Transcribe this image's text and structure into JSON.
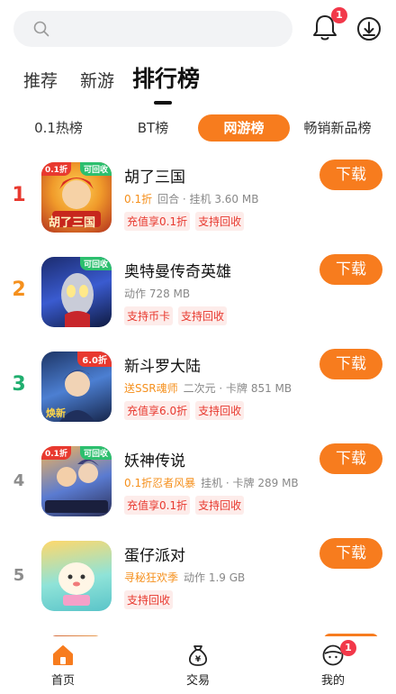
{
  "search": {
    "placeholder": ""
  },
  "header": {
    "notification_badge": "1"
  },
  "main_tabs": [
    {
      "label": "推荐"
    },
    {
      "label": "新游"
    },
    {
      "label": "排行榜"
    }
  ],
  "sub_tabs": [
    {
      "label": "0.1热榜"
    },
    {
      "label": "BT榜"
    },
    {
      "label": "网游榜"
    },
    {
      "label": "畅销新品榜"
    }
  ],
  "download_label": "下载",
  "games": [
    {
      "rank": "1",
      "rank_color": "#e8392f",
      "name": "胡了三国",
      "icon_tag": "可回收",
      "icon_tag2": "0.1折",
      "icon_caption": "胡了三国",
      "highlight": "0.1折",
      "meta": "回合 · 挂机  3.60 MB",
      "pills": [
        "充值享0.1折",
        "支持回收"
      ]
    },
    {
      "rank": "2",
      "rank_color": "#f5901d",
      "name": "奥特曼传奇英雄",
      "icon_tag": "可回收",
      "highlight": "",
      "meta": "动作  728 MB",
      "pills": [
        "支持币卡",
        "支持回收"
      ]
    },
    {
      "rank": "3",
      "rank_color": "#1fae6e",
      "name": "新斗罗大陆",
      "icon_tag": "6.0折",
      "icon_caption": "焕新",
      "highlight": "送SSR魂师",
      "meta": "二次元 · 卡牌  851 MB",
      "pills": [
        "充值享6.0折",
        "支持回收"
      ]
    },
    {
      "rank": "4",
      "rank_color": "#8c8c8c",
      "name": "妖神传说",
      "icon_tag": "可回收",
      "icon_tag2": "0.1折",
      "highlight": "0.1折忍者风暴",
      "meta": "挂机 · 卡牌  289 MB",
      "pills": [
        "充值享0.1折",
        "支持回收"
      ]
    },
    {
      "rank": "5",
      "rank_color": "#8c8c8c",
      "name": "蛋仔派对",
      "highlight": "寻秘狂欢季",
      "meta": "动作  1.9 GB",
      "pills": [
        "支持回收"
      ]
    }
  ],
  "bottom_nav": [
    {
      "label": "首页",
      "icon": "home-icon"
    },
    {
      "label": "交易",
      "icon": "money-bag-icon"
    },
    {
      "label": "我的",
      "icon": "profile-icon",
      "badge": "1"
    }
  ],
  "colors": {
    "accent": "#f77c1e",
    "badge": "#f2384a",
    "pill_text": "#e8392f",
    "pill_bg": "#fdecea",
    "highlight": "#f5901d"
  }
}
